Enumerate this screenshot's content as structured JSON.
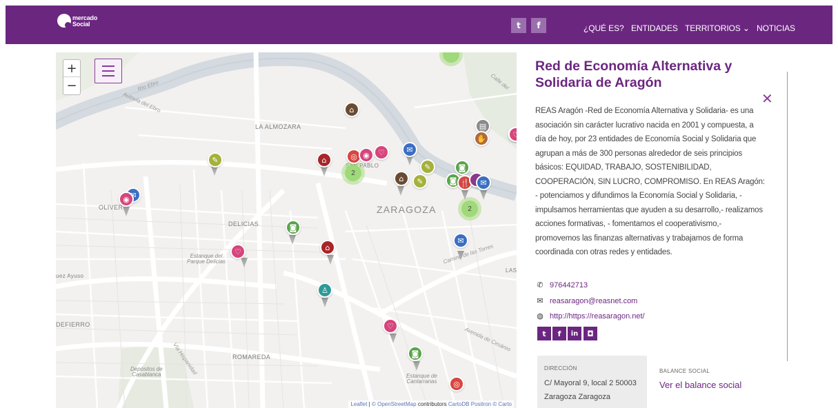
{
  "header": {
    "logo_line1": "mercado",
    "logo_line2": "Social",
    "twitter_glyph": "t",
    "facebook_glyph": "f",
    "nav": [
      "¿QUÉ ES?",
      "ENTIDADES",
      "TERRITORIOS ⌄",
      "NOTICIAS"
    ]
  },
  "map": {
    "zoom_in": "+",
    "zoom_out": "−",
    "labels": {
      "zaragoza": "ZARAGOZA",
      "la_almozara": "LA ALMOZARA",
      "delicias": "DELICIAS",
      "oliver": "OLIVER",
      "romareda": "ROMAREDA",
      "defierro": "DEFIERRO",
      "ayuso": "uez Ayuso",
      "las": "LAS",
      "san_pablo": "SAN PABLO",
      "estanque_delicias": "Estanque del\nParque Delicias",
      "deposito": "Depósitos de\nCasablanca",
      "estanque_cont": "Estanque de\nCantarranas",
      "rio_ebro": "Río Ebro",
      "autovia": "Autovía del Ebro",
      "via_hispanidad": "Vía Hispanidad",
      "camino": "Camino de las Torres",
      "avenida": "Avenida de Cesáreo",
      "calle": "Calle del"
    },
    "clusters": [
      "2",
      "2"
    ],
    "attribution": {
      "leaflet": "Leaflet",
      "osm": "© OpenStreetMap",
      "contrib": "contributors",
      "carto": "CartoDB Positron © Carto"
    }
  },
  "panel": {
    "title": "Red de Economía Alternativa y Solidaria de Aragón",
    "close": "✕",
    "description": "REAS Aragón -Red de Economía Alternativa y Solidaria- es una asociación sin carácter lucrativo nacida en 2001 y compuesta, a día de hoy, por 23 entidades de Economía Social y Solidaria que agrupan a más de 300 personas alrededor de seis principios básicos: EQUIDAD, TRABAJO, SOSTENIBILIDAD, COOPERACIÓN, SIN LUCRO, COMPROMISO. En REAS Aragón: - potenciamos y difundimos la Economía Social y Solidaria, - impulsamos herramientas que ayuden a su desarrollo,- realizamos acciones formativas, - fomentamos el cooperativismo,- promovemos las finanzas alternativas y trabajamos de forma coordinada con otras redes y entidades.",
    "phone": "976442713",
    "email": "reasaragon@reasnet.com",
    "web": "http://https://reasaragon.net/",
    "social": [
      "t",
      "f",
      "in",
      "◘"
    ],
    "address_label": "DIRECCIÓN",
    "address": "C/ Mayoral 9, local 2 50003 Zaragoza Zaragoza",
    "balance_label": "BALANCE SOCIAL",
    "balance_link": "Ver el balance social"
  },
  "colors": {
    "brand": "#6b2680",
    "marker_green": "#5aa34a",
    "marker_red": "#a8252a",
    "marker_pink": "#d6457c",
    "marker_blue": "#3b6fc2",
    "marker_olive": "#a5b13a",
    "marker_brown": "#6b4a32",
    "marker_teal": "#2e9a98"
  }
}
